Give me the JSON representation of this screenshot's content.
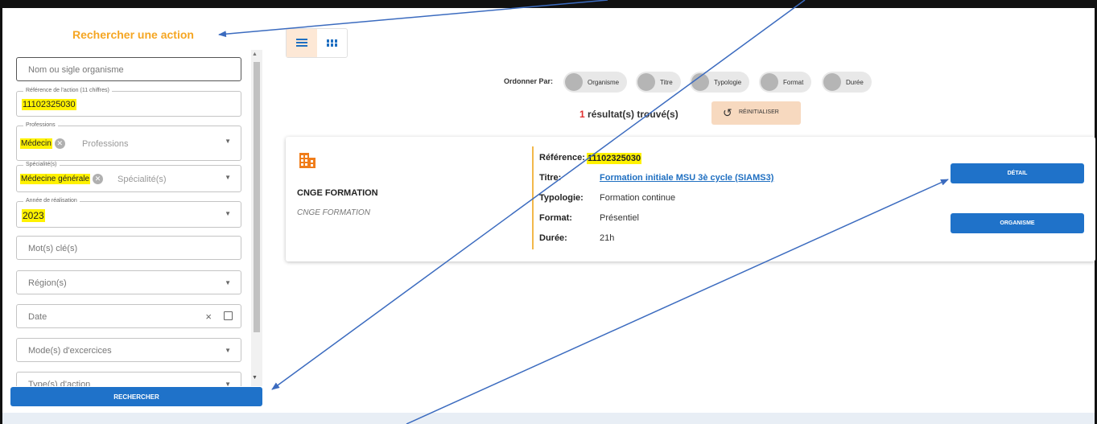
{
  "panel": {
    "title": "Rechercher une action"
  },
  "form": {
    "org_placeholder": "Nom ou sigle organisme",
    "reference": {
      "label": "Référence de l'action (11 chiffres)",
      "value": "11102325030"
    },
    "professions": {
      "label": "Professions",
      "chip": "Médecin",
      "placeholder": "Professions"
    },
    "specialites": {
      "label": "Spécialité(s)",
      "chip": "Médecine générale",
      "placeholder": "Spécialité(s)"
    },
    "annee": {
      "label": "Année de réalisation",
      "value": "2023"
    },
    "mots_cles_placeholder": "Mot(s) clé(s)",
    "regions_placeholder": "Région(s)",
    "date_placeholder": "Date",
    "modes_placeholder": "Mode(s) d'excercices",
    "types_placeholder": "Type(s) d'action",
    "search_label": "RECHERCHER"
  },
  "sort": {
    "label": "Ordonner Par:",
    "options": [
      "Organisme",
      "Titre",
      "Typologie",
      "Format",
      "Durée"
    ]
  },
  "results": {
    "count": "1",
    "text": "résultat(s) trouvé(s)",
    "reset_label": "RÉINITIALISER"
  },
  "card": {
    "org_name": "CNGE FORMATION",
    "org_sub": "CNGE FORMATION",
    "fields": {
      "reference": {
        "key": "Référence:",
        "value": "11102325030"
      },
      "titre": {
        "key": "Titre:",
        "value": "Formation initiale MSU 3è cycle (SIAMS3)"
      },
      "typologie": {
        "key": "Typologie:",
        "value": "Formation continue"
      },
      "format": {
        "key": "Format:",
        "value": "Présentiel"
      },
      "duree": {
        "key": "Durée:",
        "value": "21h"
      }
    },
    "detail_label": "DÉTAIL",
    "organisme_label": "ORGANISME"
  },
  "colors": {
    "accent": "#f5a623",
    "primary": "#1f72c9",
    "highlight": "#fff200",
    "arrow": "#3b6bbf"
  },
  "icons": [
    "building-icon",
    "list-view-icon",
    "grid-view-icon",
    "refresh-icon",
    "calendar-icon",
    "clear-icon",
    "chevron-down-icon"
  ]
}
